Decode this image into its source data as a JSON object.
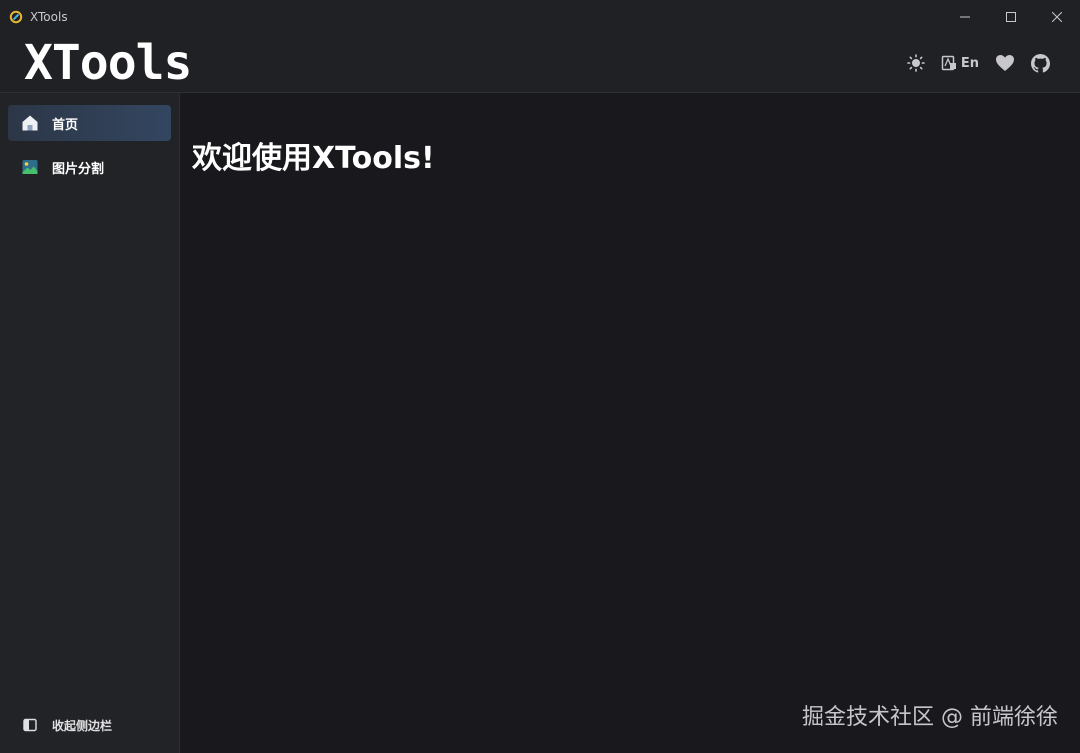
{
  "window": {
    "title": "XTools",
    "controls": [
      "minimize-icon",
      "maximize-icon",
      "close-icon"
    ]
  },
  "header": {
    "logo": "XTools",
    "actions": {
      "theme_icon": "sun-icon",
      "language_icon": "translate-icon",
      "language_label": "En",
      "favorite_icon": "heart-icon",
      "github_icon": "github-icon"
    }
  },
  "sidebar": {
    "items": [
      {
        "label": "首页",
        "icon": "home-icon",
        "active": true
      },
      {
        "label": "图片分割",
        "icon": "image-icon",
        "active": false
      }
    ],
    "collapse_label": "收起侧边栏",
    "collapse_icon": "sidebar-toggle-icon"
  },
  "main": {
    "welcome": "欢迎使用XTools!"
  },
  "watermark": "掘金技术社区 @ 前端徐徐",
  "colors": {
    "background": "#18181d",
    "sidebar": "#222327",
    "active_item": "#334660",
    "text": "#ffffff"
  }
}
